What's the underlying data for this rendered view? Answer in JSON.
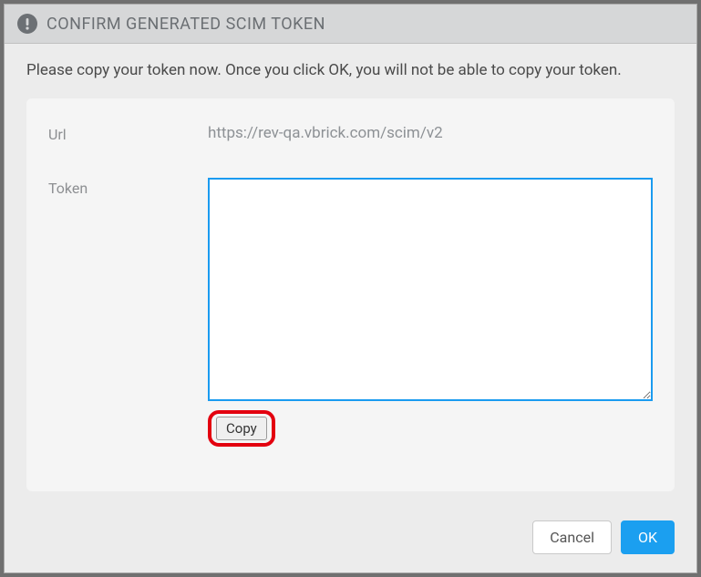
{
  "dialog": {
    "title": "CONFIRM GENERATED SCIM TOKEN",
    "instruction": "Please copy your token now. Once you click OK, you will not be able to copy your token."
  },
  "fields": {
    "url_label": "Url",
    "url_value": "https://rev-qa.vbrick.com/scim/v2",
    "token_label": "Token",
    "token_value": ""
  },
  "buttons": {
    "copy": "Copy",
    "cancel": "Cancel",
    "ok": "OK"
  }
}
